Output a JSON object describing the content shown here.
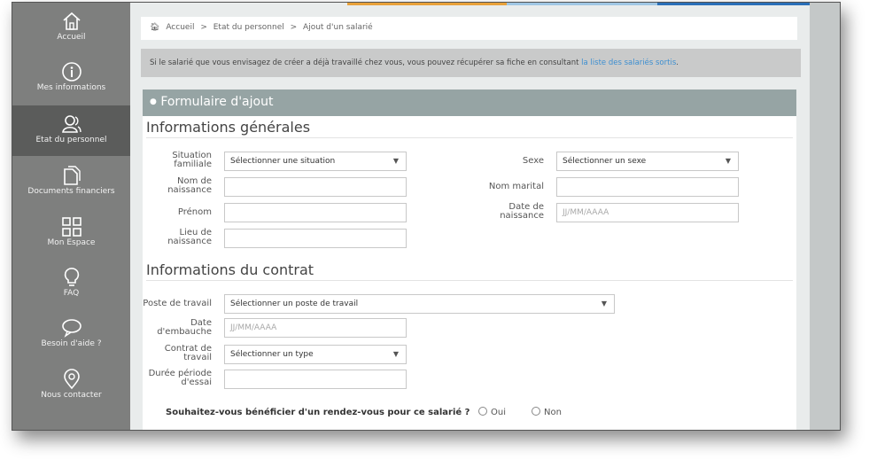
{
  "sidebar": {
    "items": [
      {
        "label": "Accueil",
        "icon": "home-icon"
      },
      {
        "label": "Mes informations",
        "icon": "info-icon"
      },
      {
        "label": "Etat du personnel",
        "icon": "users-icon"
      },
      {
        "label": "Documents financiers",
        "icon": "documents-icon"
      },
      {
        "label": "Mon Espace",
        "icon": "grid-icon"
      },
      {
        "label": "FAQ",
        "icon": "bulb-icon"
      },
      {
        "label": "Besoin d'aide ?",
        "icon": "chat-icon"
      },
      {
        "label": "Nous contacter",
        "icon": "location-icon"
      }
    ]
  },
  "colors": {
    "accent_orange": "#e8a13a",
    "accent_blue": "#2a6fb8",
    "sidebar": "#7e7f7e",
    "sidebar_active": "#5b5c5b",
    "form_header": "#96a4a4",
    "link": "#3d8fd1"
  },
  "breadcrumb": {
    "home": "Accueil",
    "sep": ">",
    "level1": "Etat du personnel",
    "level2": "Ajout d'un salarié"
  },
  "notice": {
    "text": "Si le salarié que vous envisagez de créer a déjà travaillé chez vous, vous pouvez récupérer sa fiche en consultant ",
    "link": "la liste des salariés sortis",
    "end": "."
  },
  "form": {
    "title": "Formulaire d'ajout",
    "general": {
      "title": "Informations générales",
      "situation_label_1": "Situation",
      "situation_label_2": "familiale",
      "situation_value": "Sélectionner une situation",
      "sexe_label": "Sexe",
      "sexe_value": "Sélectionner un sexe",
      "nom_label_1": "Nom de",
      "nom_label_2": "naissance",
      "nom_value": "",
      "nom_marital_label": "Nom marital",
      "nom_marital_value": "",
      "prenom_label": "Prénom",
      "prenom_value": "",
      "date_label_1": "Date de",
      "date_label_2": "naissance",
      "date_placeholder": "JJ/MM/AAAA",
      "lieu_label_1": "Lieu de",
      "lieu_label_2": "naissance",
      "lieu_value": ""
    },
    "contract": {
      "title": "Informations du contrat",
      "poste_label": "Poste de travail",
      "poste_value": "Sélectionner un poste de travail",
      "embauche_label_1": "Date",
      "embauche_label_2": "d'embauche",
      "embauche_placeholder": "JJ/MM/AAAA",
      "contrat_label_1": "Contrat de",
      "contrat_label_2": "travail",
      "contrat_value": "Sélectionner un type",
      "essai_label_1": "Durée période",
      "essai_label_2": "d'essai",
      "essai_value": ""
    },
    "question": "Souhaitez-vous bénéficier d'un rendez-vous pour ce salarié ?",
    "option_yes": "Oui",
    "option_no": "Non"
  }
}
